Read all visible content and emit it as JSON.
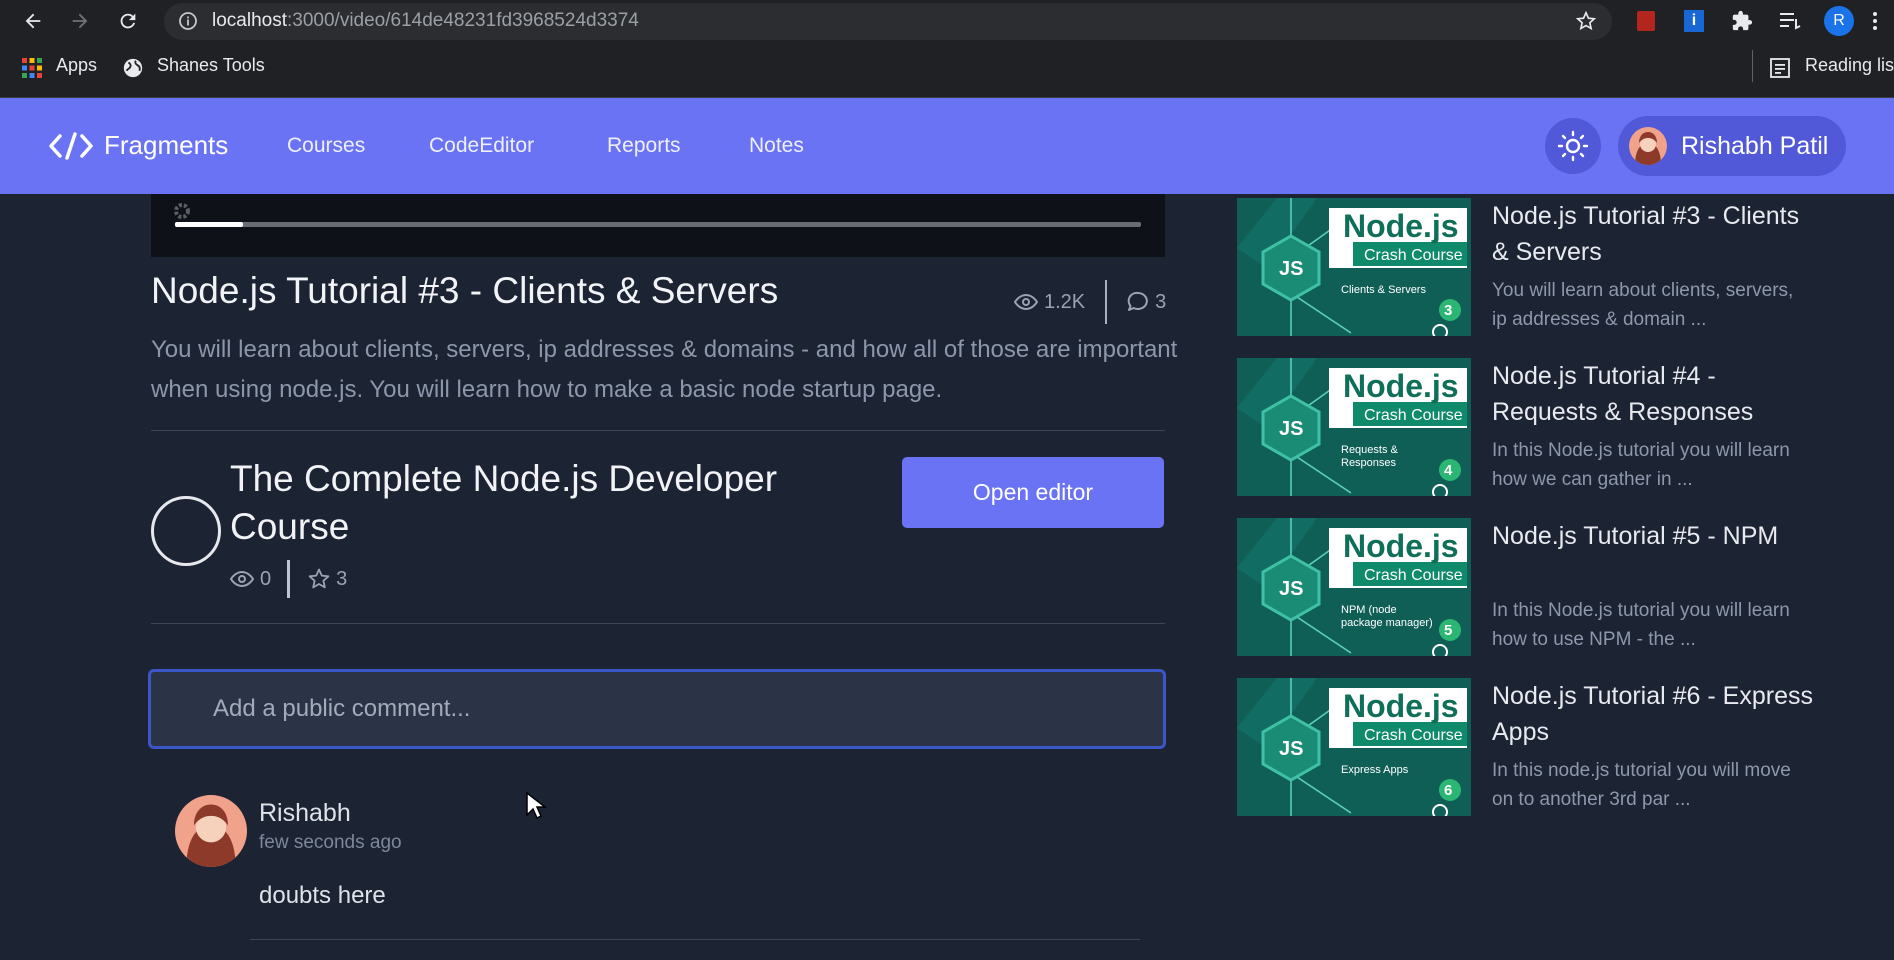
{
  "browser": {
    "url_host": "localhost",
    "url_path": ":3000/video/614de48231fd3968524d3374",
    "profile_initial": "R",
    "bookmarks": {
      "apps": "Apps",
      "shanes_tools": "Shanes Tools",
      "reading_list": "Reading list"
    }
  },
  "navbar": {
    "brand": "Fragments",
    "links": [
      "Courses",
      "CodeEditor",
      "Reports",
      "Notes"
    ],
    "user_name": "Rishabh Patil"
  },
  "video": {
    "progress_fraction": 0.07,
    "title": "Node.js Tutorial #3 - Clients & Servers",
    "views": "1.2K",
    "comments": "3",
    "description": "You will learn about clients, servers, ip addresses & domains - and how all of those are important when using node.js. You will learn how to make a basic node startup page."
  },
  "course": {
    "title": "The Complete Node.js Developer Course",
    "views": "0",
    "stars": "3",
    "open_editor": "Open editor"
  },
  "comment_box": {
    "placeholder": "Add a public comment..."
  },
  "comments": [
    {
      "author": "Rishabh",
      "time": "few seconds ago",
      "text": "doubts here"
    }
  ],
  "related": [
    {
      "title": "Node.js Tutorial #3 - Clients & Servers",
      "desc": "You will learn about clients, servers, ip addresses & domain ...",
      "thumb_brand": "Node.js",
      "thumb_sub": "Crash Course",
      "thumb_js": "JS",
      "thumb_topic": "Clients & Servers",
      "thumb_num": "3"
    },
    {
      "title": "Node.js Tutorial #4 - Requests & Responses",
      "desc": "In this Node.js tutorial you will learn how we can gather in ...",
      "thumb_brand": "Node.js",
      "thumb_sub": "Crash Course",
      "thumb_js": "JS",
      "thumb_topic": "Requests & Responses",
      "thumb_num": "4"
    },
    {
      "title": "Node.js Tutorial #5 - NPM",
      "desc": "In this Node.js tutorial you will learn how to use NPM - the ...",
      "thumb_brand": "Node.js",
      "thumb_sub": "Crash Course",
      "thumb_js": "JS",
      "thumb_topic": "NPM (node package manager)",
      "thumb_num": "5"
    },
    {
      "title": "Node.js Tutorial #6 - Express Apps",
      "desc": "In this node.js tutorial you will move on to another 3rd par ...",
      "thumb_brand": "Node.js",
      "thumb_sub": "Crash Course",
      "thumb_js": "JS",
      "thumb_topic": "Express Apps",
      "thumb_num": "6"
    }
  ],
  "colors": {
    "accent": "#6a73f4",
    "background": "#1c2332",
    "thumb_green": "#0f5f57"
  }
}
